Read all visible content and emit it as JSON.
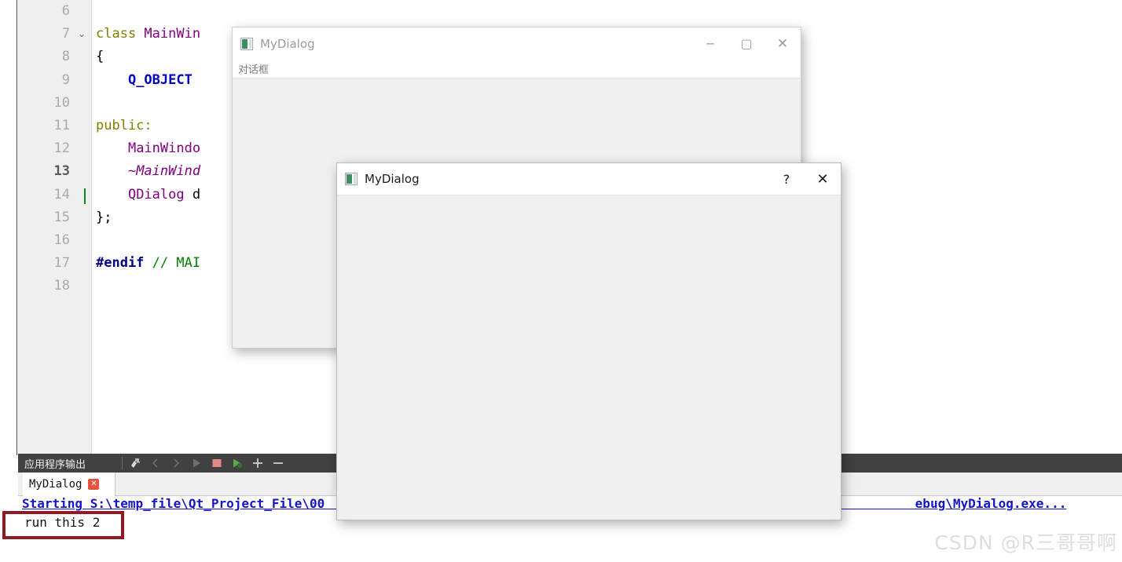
{
  "editor": {
    "lines": [
      {
        "num": "6",
        "fold": "",
        "current": false,
        "caret": false,
        "tokens": []
      },
      {
        "num": "7",
        "fold": "⌄",
        "current": false,
        "caret": false,
        "tokens": [
          {
            "t": "class ",
            "c": "kw"
          },
          {
            "t": "MainWin",
            "c": "type"
          }
        ]
      },
      {
        "num": "8",
        "fold": "",
        "current": false,
        "caret": false,
        "tokens": [
          {
            "t": "{",
            "c": "pln"
          }
        ]
      },
      {
        "num": "9",
        "fold": "",
        "current": false,
        "caret": false,
        "tokens": [
          {
            "t": "    ",
            "c": "pln"
          },
          {
            "t": "Q_OBJECT",
            "c": "mac"
          }
        ]
      },
      {
        "num": "10",
        "fold": "",
        "current": false,
        "caret": false,
        "tokens": []
      },
      {
        "num": "11",
        "fold": "",
        "current": false,
        "caret": false,
        "tokens": [
          {
            "t": "public:",
            "c": "kw"
          }
        ]
      },
      {
        "num": "12",
        "fold": "",
        "current": false,
        "caret": false,
        "tokens": [
          {
            "t": "    ",
            "c": "pln"
          },
          {
            "t": "MainWindo",
            "c": "type"
          }
        ]
      },
      {
        "num": "13",
        "fold": "",
        "current": true,
        "caret": false,
        "tokens": [
          {
            "t": "    ",
            "c": "pln"
          },
          {
            "t": "~MainWind",
            "c": "ital"
          }
        ]
      },
      {
        "num": "14",
        "fold": "",
        "current": false,
        "caret": true,
        "tokens": [
          {
            "t": "    ",
            "c": "pln"
          },
          {
            "t": "QDialog ",
            "c": "type"
          },
          {
            "t": "d",
            "c": "pln"
          }
        ]
      },
      {
        "num": "15",
        "fold": "",
        "current": false,
        "caret": false,
        "tokens": [
          {
            "t": "};",
            "c": "pln"
          }
        ]
      },
      {
        "num": "16",
        "fold": "",
        "current": false,
        "caret": false,
        "tokens": []
      },
      {
        "num": "17",
        "fold": "",
        "current": false,
        "caret": false,
        "tokens": [
          {
            "t": "#endif ",
            "c": "pre"
          },
          {
            "t": "// MAI",
            "c": "cmt"
          }
        ]
      },
      {
        "num": "18",
        "fold": "",
        "current": false,
        "caret": false,
        "tokens": []
      }
    ]
  },
  "output_pane": {
    "title": "应用程序输出",
    "icons": [
      "clear-pane-icon",
      "prev-item-icon",
      "next-item-icon",
      "run-icon",
      "stop-icon",
      "run-debug-icon",
      "zoom-in-icon",
      "zoom-out-icon"
    ],
    "tab": {
      "label": "MyDialog",
      "close_glyph": "✕"
    },
    "lines": {
      "line1": "Starting S:\\temp_file\\Qt_Project_File\\00                                                                              ebug\\MyDialog.exe...",
      "line2": "run this 2"
    },
    "highlight_color": "#8f1a25"
  },
  "dialog_back": {
    "title": "MyDialog",
    "icon": "app-window-icon",
    "menubar_item": "对话框",
    "controls": [
      {
        "name": "minimize-button",
        "glyph": "─"
      },
      {
        "name": "maximize-button",
        "glyph": "▢"
      },
      {
        "name": "close-button",
        "glyph": "✕"
      }
    ],
    "title_color": "#9b9b9b",
    "control_color": "#9b9b9b"
  },
  "dialog_front": {
    "title": "MyDialog",
    "icon": "app-window-icon",
    "controls": [
      {
        "name": "help-button",
        "glyph": "?"
      },
      {
        "name": "close-button",
        "glyph": "✕"
      }
    ],
    "title_color": "#1a1a1a",
    "control_color": "#1a1a1a"
  },
  "watermark": {
    "text": "CSDN @R三哥哥啊"
  }
}
